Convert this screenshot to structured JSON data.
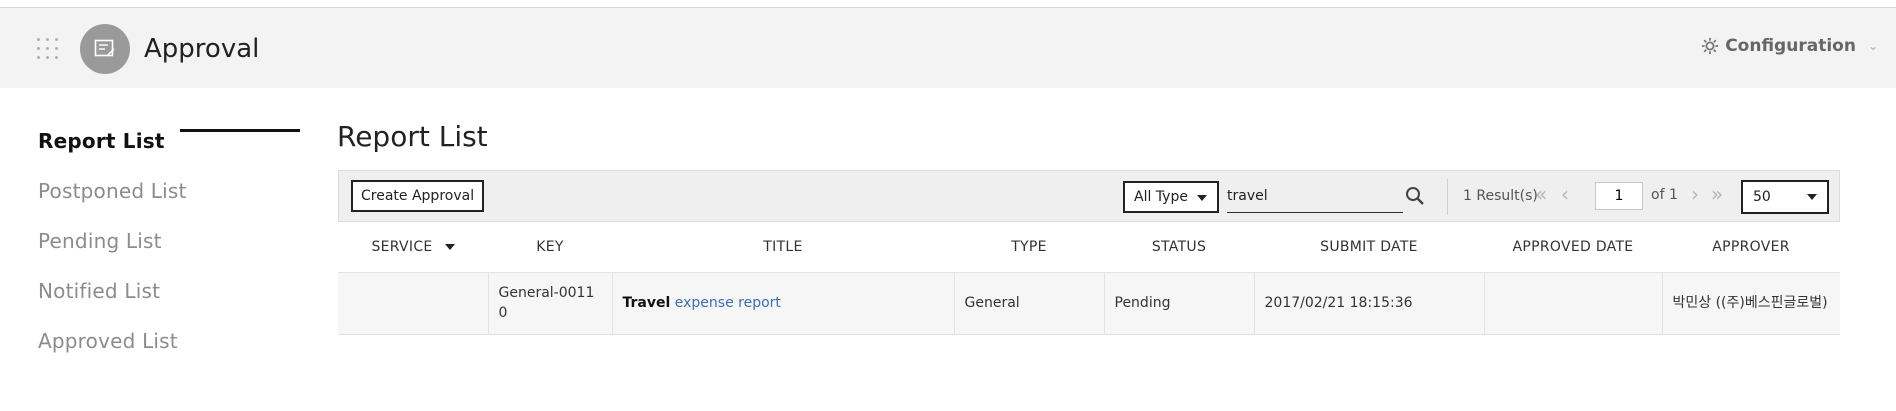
{
  "header": {
    "app_title": "Approval",
    "config_label": "Configuration"
  },
  "sidebar": {
    "items": [
      {
        "label": "Report List",
        "active": true
      },
      {
        "label": "Postponed List",
        "active": false
      },
      {
        "label": "Pending List",
        "active": false
      },
      {
        "label": "Notified List",
        "active": false
      },
      {
        "label": "Approved List",
        "active": false
      }
    ]
  },
  "main": {
    "title": "Report List",
    "toolbar": {
      "create_label": "Create Approval",
      "type_filter": "All Type",
      "search_value": "travel",
      "result_count": "1 Result(s)",
      "page_current": "1",
      "page_of": "of 1",
      "page_size": "50"
    },
    "table": {
      "columns": [
        "SERVICE",
        "KEY",
        "TITLE",
        "TYPE",
        "STATUS",
        "SUBMIT DATE",
        "APPROVED DATE",
        "APPROVER"
      ],
      "rows": [
        {
          "service": "",
          "key": "General-00110",
          "title_bold": "Travel",
          "title_rest": "expense report",
          "type": "General",
          "status": "Pending",
          "submit_date": "2017/02/21 18:15:36",
          "approved_date": "",
          "approver": "박민상 ((주)베스핀글로벌)"
        }
      ]
    }
  }
}
